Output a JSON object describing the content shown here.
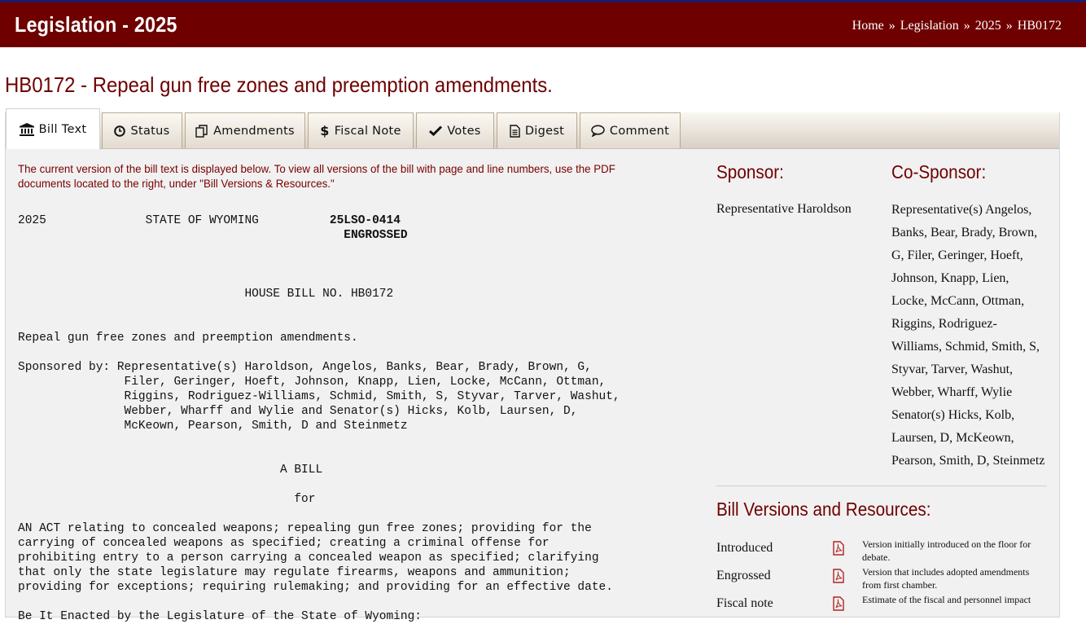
{
  "header": {
    "site_title": "Legislation - 2025",
    "breadcrumb": [
      "Home",
      "Legislation",
      "2025",
      "HB0172"
    ],
    "separator": "»"
  },
  "page_title": "HB0172 - Repeal gun free zones and preemption amendments.",
  "tabs": [
    {
      "label": "Bill Text",
      "icon": "bank-icon",
      "active": true
    },
    {
      "label": "Status",
      "icon": "clock-icon",
      "active": false
    },
    {
      "label": "Amendments",
      "icon": "copy-icon",
      "active": false
    },
    {
      "label": "Fiscal Note",
      "icon": "dollar-icon",
      "active": false
    },
    {
      "label": "Votes",
      "icon": "check-icon",
      "active": false
    },
    {
      "label": "Digest",
      "icon": "document-icon",
      "active": false
    },
    {
      "label": "Comment",
      "icon": "comment-icon",
      "active": false
    }
  ],
  "notice": "The current version of the bill text is displayed below. To view all versions of the bill with page and line numbers, use the PDF documents located to the right, under \"Bill Versions & Resources.\"",
  "bill": {
    "year": "2025",
    "state": "STATE OF WYOMING",
    "lso_number": "25LSO-0414",
    "stage": "ENGROSSED",
    "bill_number": "HOUSE BILL NO. HB0172",
    "title": "Repeal gun free zones and preemption amendments.",
    "sponsored_by_label": "Sponsored by:",
    "sponsored_by_lines": [
      "Representative(s) Haroldson, Angelos, Banks, Bear, Brady, Brown, G,",
      "Filer, Geringer, Hoeft, Johnson, Knapp, Lien, Locke, McCann, Ottman,",
      "Riggins, Rodriguez-Williams, Schmid, Smith, S, Styvar, Tarver, Washut,",
      "Webber, Wharff and Wylie and Senator(s) Hicks, Kolb, Laursen, D,",
      "McKeown, Pearson, Smith, D and Steinmetz"
    ],
    "a_bill": "A BILL",
    "for": "for",
    "act_lines": [
      "AN ACT relating to concealed weapons; repealing gun free zones; providing for the",
      "carrying of concealed weapons as specified; creating a criminal offense for",
      "prohibiting entry to a person carrying a concealed weapon as specified; clarifying",
      "that only the state legislature may regulate firearms, weapons and ammunition;",
      "providing for exceptions; requiring rulemaking; and providing for an effective date."
    ],
    "enacting_clause": "Be It Enacted by the Legislature of the State of Wyoming:"
  },
  "sidebar": {
    "sponsor_heading": "Sponsor:",
    "cosponsor_heading": "Co-Sponsor:",
    "sponsor": "Representative Haroldson",
    "cosponsor_lines": [
      "Representative(s) Angelos,",
      "Banks, Bear, Brady, Brown,",
      "G, Filer, Geringer, Hoeft,",
      "Johnson, Knapp, Lien,",
      "Locke, McCann, Ottman,",
      "Riggins, Rodriguez-",
      "Williams, Schmid, Smith, S,",
      "Styvar, Tarver, Washut,",
      "Webber, Wharff, Wylie",
      "Senator(s) Hicks, Kolb,",
      "Laursen, D, McKeown,",
      "Pearson, Smith, D, Steinmetz"
    ],
    "resources_heading": "Bill Versions and Resources:",
    "resources": [
      {
        "name": "Introduced",
        "icon": "pdf-icon",
        "description": "Version initially introduced on the floor for debate."
      },
      {
        "name": "Engrossed",
        "icon": "pdf-icon",
        "description": "Version that includes adopted amendments from first chamber."
      },
      {
        "name": "Fiscal note",
        "icon": "pdf-icon",
        "description": "Estimate of the fiscal and personnel impact"
      }
    ]
  },
  "colors": {
    "brand": "#6e0000",
    "header_border": "#1d1b6b",
    "panel": "#f1f1f1"
  }
}
